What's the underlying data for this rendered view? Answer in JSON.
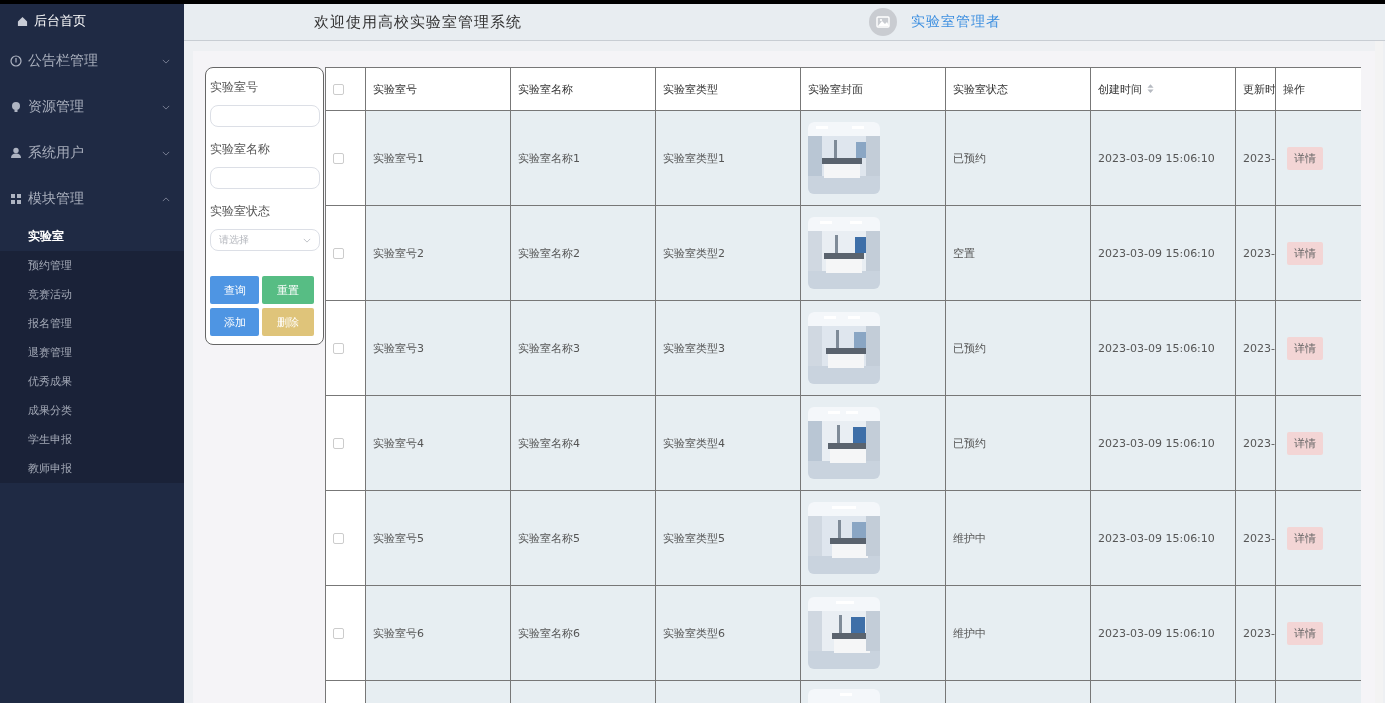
{
  "sidebar": {
    "home": "后台首页",
    "groups": [
      {
        "label": "公告栏管理",
        "expanded": false
      },
      {
        "label": "资源管理",
        "expanded": false
      },
      {
        "label": "系统用户",
        "expanded": false
      },
      {
        "label": "模块管理",
        "expanded": true,
        "children": [
          {
            "label": "实验室",
            "selected": true
          },
          {
            "label": "预约管理",
            "selected": false
          },
          {
            "label": "竞赛活动",
            "selected": false
          },
          {
            "label": "报名管理",
            "selected": false
          },
          {
            "label": "退赛管理",
            "selected": false
          },
          {
            "label": "优秀成果",
            "selected": false
          },
          {
            "label": "成果分类",
            "selected": false
          },
          {
            "label": "学生申报",
            "selected": false
          },
          {
            "label": "教师申报",
            "selected": false
          }
        ]
      }
    ]
  },
  "header": {
    "title": "欢迎使用高校实验室管理系统",
    "user": "实验室管理者"
  },
  "filters": {
    "fields": [
      {
        "label": "实验室号",
        "kind": "input"
      },
      {
        "label": "实验室名称",
        "kind": "input"
      },
      {
        "label": "实验室状态",
        "kind": "select",
        "placeholder": "请选择"
      }
    ],
    "buttons": [
      {
        "label": "查询",
        "kind": "query"
      },
      {
        "label": "重置",
        "kind": "reset"
      },
      {
        "label": "添加",
        "kind": "add"
      },
      {
        "label": "删除",
        "kind": "delete"
      }
    ]
  },
  "table": {
    "all_checked": false,
    "columns": [
      {
        "label": "实验室号",
        "sortable": false
      },
      {
        "label": "实验室名称",
        "sortable": false
      },
      {
        "label": "实验室类型",
        "sortable": false
      },
      {
        "label": "实验室封面",
        "sortable": false
      },
      {
        "label": "实验室状态",
        "sortable": false
      },
      {
        "label": "创建时间",
        "sortable": true
      },
      {
        "label": "更新时"
      }
    ],
    "action_column": "操作",
    "rows": [
      {
        "checked": false,
        "number": "实验室号1",
        "name": "实验室名称1",
        "type": "实验室类型1",
        "status": "已预约",
        "created": "2023-03-09 15:06:10",
        "updated": "2023-",
        "action": "详情"
      },
      {
        "checked": false,
        "number": "实验室号2",
        "name": "实验室名称2",
        "type": "实验室类型2",
        "status": "空置",
        "created": "2023-03-09 15:06:10",
        "updated": "2023-",
        "action": "详情"
      },
      {
        "checked": false,
        "number": "实验室号3",
        "name": "实验室名称3",
        "type": "实验室类型3",
        "status": "已预约",
        "created": "2023-03-09 15:06:10",
        "updated": "2023-",
        "action": "详情"
      },
      {
        "checked": false,
        "number": "实验室号4",
        "name": "实验室名称4",
        "type": "实验室类型4",
        "status": "已预约",
        "created": "2023-03-09 15:06:10",
        "updated": "2023-",
        "action": "详情"
      },
      {
        "checked": false,
        "number": "实验室号5",
        "name": "实验室名称5",
        "type": "实验室类型5",
        "status": "维护中",
        "created": "2023-03-09 15:06:10",
        "updated": "2023-",
        "action": "详情"
      },
      {
        "checked": false,
        "number": "实验室号6",
        "name": "实验室名称6",
        "type": "实验室类型6",
        "status": "维护中",
        "created": "2023-03-09 15:06:10",
        "updated": "2023-",
        "action": "详情"
      },
      {
        "kind": "picture"
      }
    ]
  }
}
